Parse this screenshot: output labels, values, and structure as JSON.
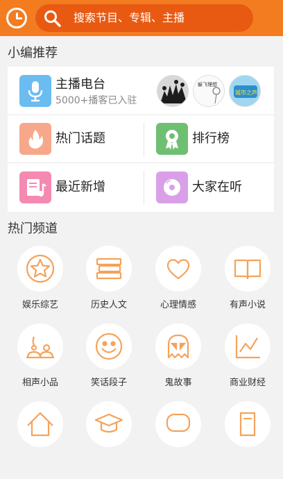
{
  "header": {
    "search_placeholder": "搜索节目、专辑、主播"
  },
  "recommend": {
    "title": "小编推荐",
    "anchor": {
      "label": "主播电台",
      "sub": "5000+播客已入驻"
    },
    "items": [
      {
        "label": "热门话题"
      },
      {
        "label": "排行榜"
      },
      {
        "label": "最近新增"
      },
      {
        "label": "大家在听"
      }
    ],
    "avatar_texts": [
      "躲飞理想",
      "城市之声"
    ]
  },
  "channels": {
    "title": "热门频道",
    "items": [
      {
        "label": "娱乐综艺",
        "icon": "star-icon"
      },
      {
        "label": "历史人文",
        "icon": "books-icon"
      },
      {
        "label": "心理情感",
        "icon": "heart-icon"
      },
      {
        "label": "有声小说",
        "icon": "open-book-icon"
      },
      {
        "label": "相声小品",
        "icon": "performers-icon"
      },
      {
        "label": "笑话段子",
        "icon": "smiley-icon"
      },
      {
        "label": "鬼故事",
        "icon": "ghost-icon"
      },
      {
        "label": "商业财经",
        "icon": "chart-icon"
      }
    ]
  },
  "colors": {
    "accent": "#f47c20",
    "icon_stroke": "#f5a25a",
    "anchor_tile": "#6bbcf0",
    "hot_tile": "#f7a88a",
    "rank_tile": "#6fbf73",
    "new_tile": "#f48ab2",
    "listen_tile": "#d9a0e8"
  }
}
